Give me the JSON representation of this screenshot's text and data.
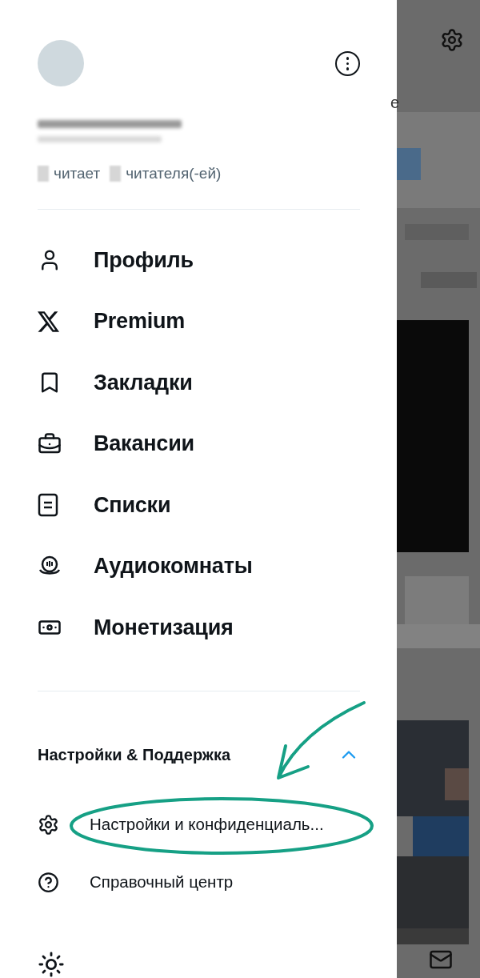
{
  "profile": {
    "following_label": "читает",
    "followers_label": "читателя(-ей)"
  },
  "menu": [
    {
      "kind": "profile",
      "label": "Профиль"
    },
    {
      "kind": "premium",
      "label": "Premium"
    },
    {
      "kind": "bookmarks",
      "label": "Закладки"
    },
    {
      "kind": "jobs",
      "label": "Вакансии"
    },
    {
      "kind": "lists",
      "label": "Списки"
    },
    {
      "kind": "spaces",
      "label": "Аудиокомнаты"
    },
    {
      "kind": "monetization",
      "label": "Монетизация"
    }
  ],
  "section": {
    "title": "Настройки & Поддержка",
    "expanded": true,
    "items": [
      {
        "kind": "settings",
        "label": "Настройки и конфиденциаль..."
      },
      {
        "kind": "help",
        "label": "Справочный центр"
      }
    ]
  },
  "background": {
    "peek_text": "e"
  }
}
